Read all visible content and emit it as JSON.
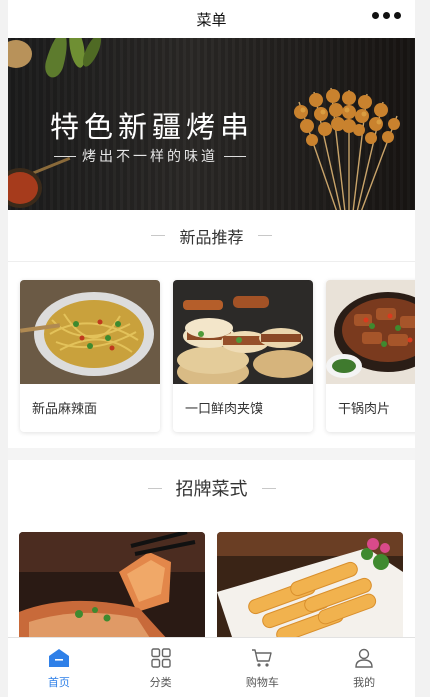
{
  "header": {
    "title": "菜单",
    "more_icon": "more-dots-icon"
  },
  "banner": {
    "headline": "特色新疆烤串",
    "subline": "烤出不一样的味道"
  },
  "new_section": {
    "title": "新品推荐",
    "items": [
      {
        "name": "新品麻辣面"
      },
      {
        "name": "一口鲜肉夹馍"
      },
      {
        "name": "干锅肉片"
      }
    ]
  },
  "signature_section": {
    "title": "招牌菜式"
  },
  "tabbar": {
    "active_color": "#2f80e8",
    "items": [
      {
        "label": "首页",
        "icon": "home-icon"
      },
      {
        "label": "分类",
        "icon": "grid-icon"
      },
      {
        "label": "购物车",
        "icon": "cart-icon"
      },
      {
        "label": "我的",
        "icon": "user-icon"
      }
    ]
  }
}
